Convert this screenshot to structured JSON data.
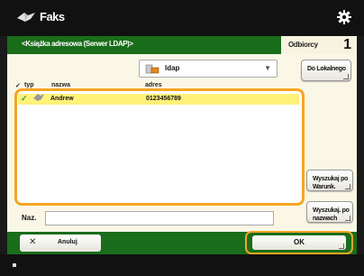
{
  "header": {
    "title": "Faks",
    "icon": "fax-icon",
    "settings_icon": "gear-icon"
  },
  "crumbbar": {
    "path": "<Książka adresowa (Serwer LDAP)>",
    "recipients_label": "Odbiorcy",
    "recipients_count": "1"
  },
  "server_select": {
    "value": "ldap",
    "icon": "server-icon"
  },
  "side_buttons": {
    "to_local": "Do Lokalnego",
    "search_by_conditions": "Wyszukaj po Warunk.",
    "search_by_name": "Wyszukaj. po nazwach"
  },
  "list": {
    "columns": {
      "type": "typ",
      "name": "nazwa",
      "address": "adres"
    },
    "rows": [
      {
        "checked": true,
        "icon": "fax-icon",
        "name": "Andrew",
        "address": "0123456789"
      }
    ]
  },
  "name_field": {
    "label": "Naz.",
    "value": ""
  },
  "footer_buttons": {
    "cancel": "Anuluj",
    "ok": "OK"
  },
  "colors": {
    "accent": "#f5a623",
    "bar_green": "#1a6d1a",
    "row_highlight": "#fff17a",
    "check_green": "#2e9c2e"
  }
}
